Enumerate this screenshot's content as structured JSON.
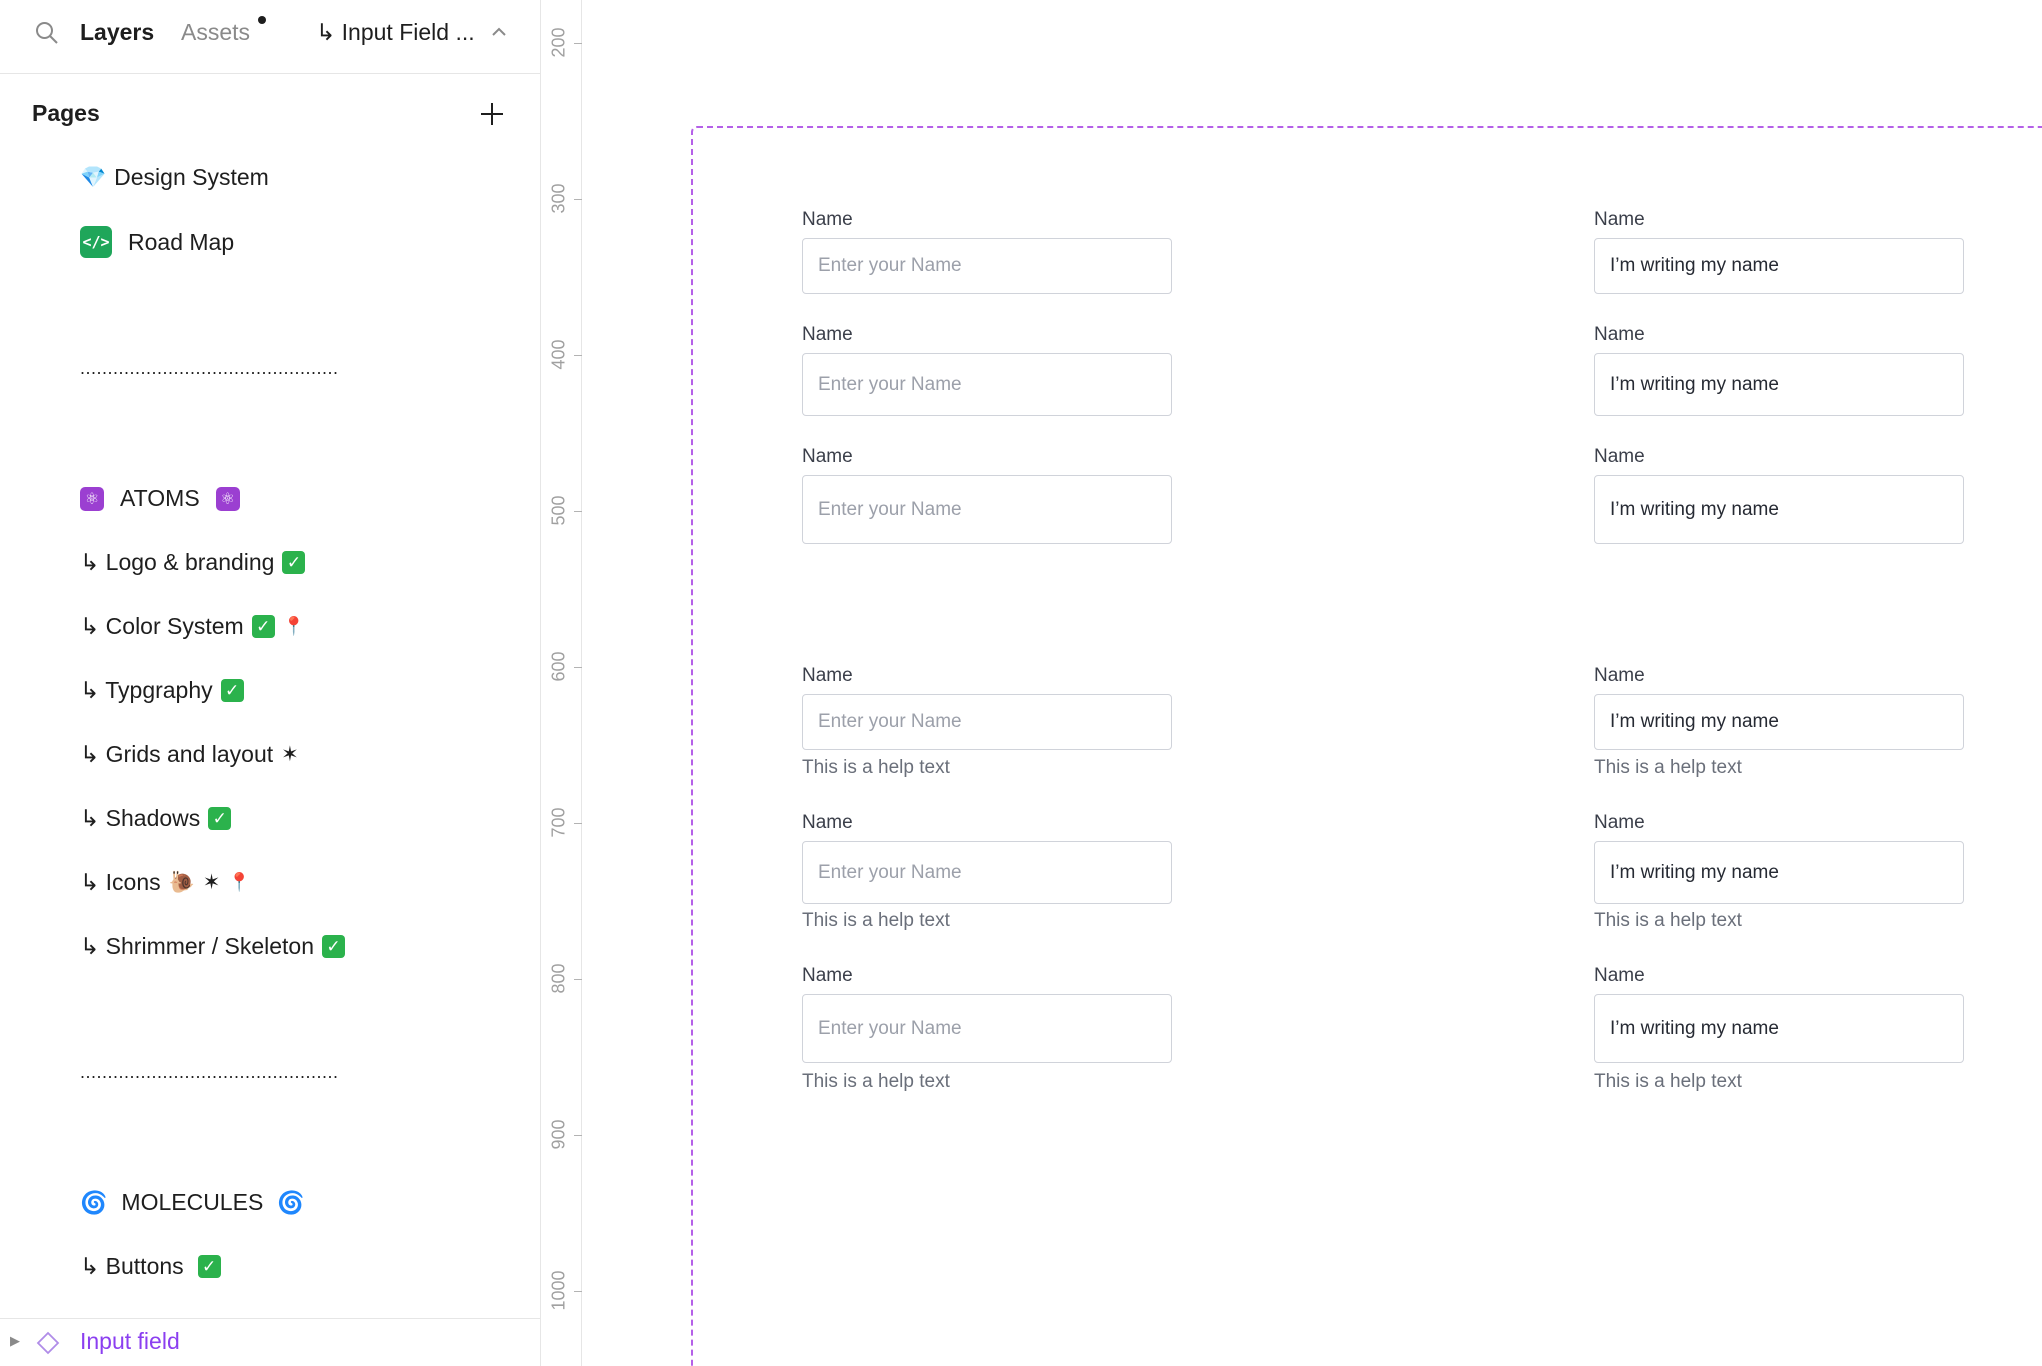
{
  "sidebar": {
    "tabs": {
      "layers": "Layers",
      "assets": "Assets"
    },
    "current_page": "↳ Input Field ...",
    "pages_header": "Pages",
    "divider": "...............................................",
    "pages": {
      "design_system": "Design System",
      "road_map": "Road Map",
      "atoms": "ATOMS",
      "logo_branding": "↳ Logo & branding",
      "color_system": "↳ Color System",
      "typography": "↳ Typgraphy",
      "grids_layout": "↳ Grids and layout",
      "shadows": "↳ Shadows",
      "icons": "↳ Icons",
      "shrimmer": "↳ Shrimmer / Skeleton",
      "molecules": "MOLECULES",
      "buttons": "↳ Buttons"
    },
    "layer": {
      "name": "Input field"
    }
  },
  "ruler": {
    "labels": [
      "200",
      "300",
      "400",
      "500",
      "600",
      "700",
      "800",
      "900",
      "1000"
    ]
  },
  "canvas": {
    "label": "Name",
    "placeholder": "Enter your Name",
    "filled_value": "I’m writing my name",
    "help": "This is a help text"
  },
  "colors": {
    "accent_purple": "#8b3ff0",
    "frame_dash": "#b560e8",
    "check_green": "#2bb24c"
  }
}
